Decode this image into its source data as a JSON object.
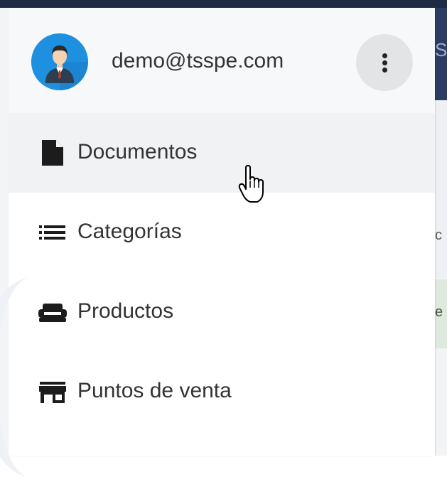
{
  "user": {
    "email": "demo@tsspe.com",
    "avatar_icon": "user-avatar"
  },
  "header": {
    "more_icon": "more-vertical-icon"
  },
  "menu": {
    "items": [
      {
        "label": "Documentos",
        "icon": "document-icon",
        "active": true
      },
      {
        "label": "Categorías",
        "icon": "list-icon",
        "active": false
      },
      {
        "label": "Productos",
        "icon": "sofa-icon",
        "active": false
      },
      {
        "label": "Puntos de venta",
        "icon": "store-icon",
        "active": false
      }
    ]
  },
  "background": {
    "header_fragment": "S",
    "fragment_1": "c",
    "fragment_2": "e"
  },
  "colors": {
    "topbar": "#1f2a44",
    "avatar_bg": "#1e90e0",
    "active_item_bg": "#f1f2f4",
    "header_bg": "#f7f8fa"
  }
}
